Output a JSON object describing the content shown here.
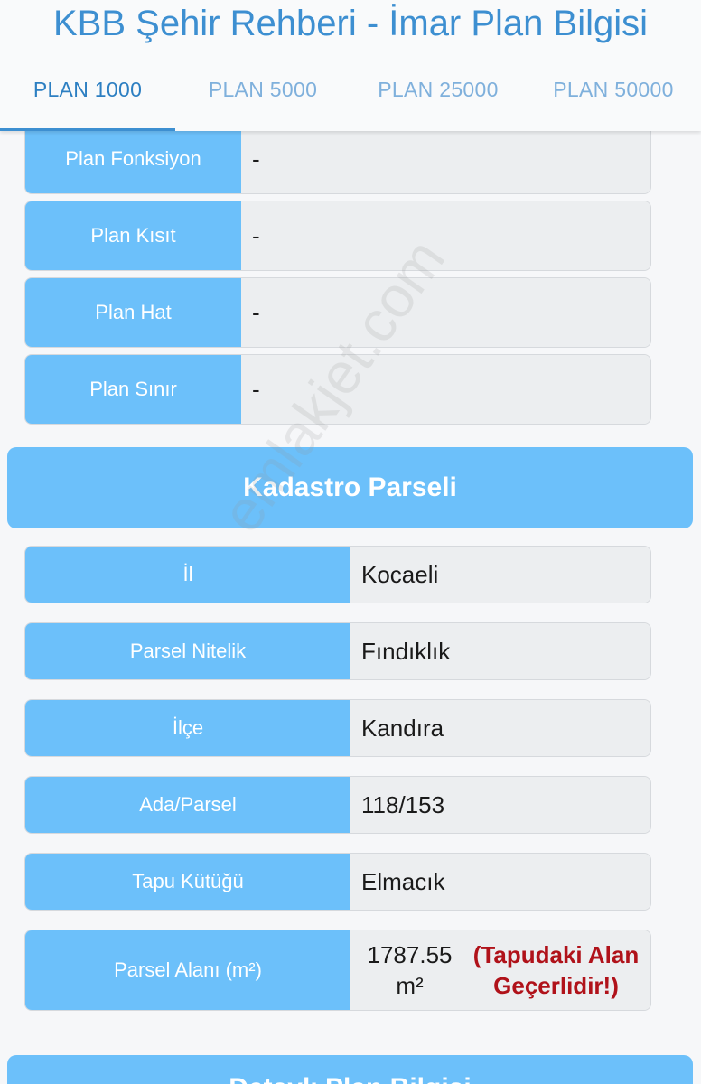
{
  "header": {
    "title": "KBB Şehir Rehberi - İmar Plan Bilgisi",
    "tabs": [
      {
        "label": "PLAN 1000",
        "active": true
      },
      {
        "label": "PLAN 5000",
        "active": false
      },
      {
        "label": "PLAN 25000",
        "active": false
      },
      {
        "label": "PLAN 50000",
        "active": false
      }
    ]
  },
  "plan_rows": [
    {
      "label": "Plan Fonksiyon",
      "value": "-"
    },
    {
      "label": "Plan Kısıt",
      "value": "-"
    },
    {
      "label": "Plan Hat",
      "value": "-"
    },
    {
      "label": "Plan Sınır",
      "value": "-"
    }
  ],
  "kadastro": {
    "section_title": "Kadastro Parseli",
    "rows": [
      {
        "label": "İl",
        "value": "Kocaeli"
      },
      {
        "label": "Parsel Nitelik",
        "value": "Fındıklık"
      },
      {
        "label": "İlçe",
        "value": "Kandıra"
      },
      {
        "label": "Ada/Parsel",
        "value": "118/153"
      },
      {
        "label": "Tapu Kütüğü",
        "value": "Elmacık"
      }
    ],
    "area": {
      "label": "Parsel Alanı (m²)",
      "value": "1787.55 m²",
      "note": "(Tapudaki Alan Geçerlidir!)"
    }
  },
  "next_section_title": "Detaylı Plan Bilgisi",
  "watermark": "emlakjet.com",
  "colors": {
    "accent": "#6cc0fa",
    "title": "#3d8fd1",
    "warning": "#b0121a"
  }
}
